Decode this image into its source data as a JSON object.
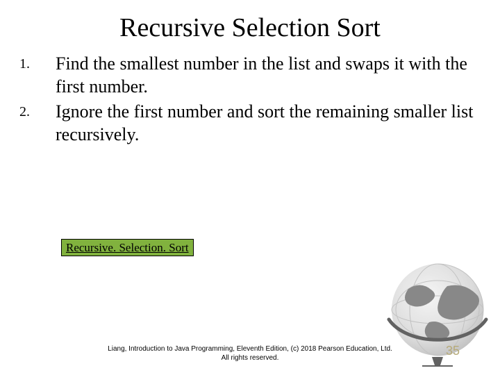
{
  "title": "Recursive Selection Sort",
  "items": [
    {
      "num": "1.",
      "text": "Find the smallest number in the list and swaps it with the first number."
    },
    {
      "num": "2.",
      "text": "Ignore the first number and sort the remaining smaller list recursively."
    }
  ],
  "link_label": "Recursive. Selection. Sort",
  "footer_line1": "Liang, Introduction to Java Programming, Eleventh Edition, (c) 2018 Pearson Education, Ltd.",
  "footer_line2": "All rights reserved.",
  "page_number": "35"
}
